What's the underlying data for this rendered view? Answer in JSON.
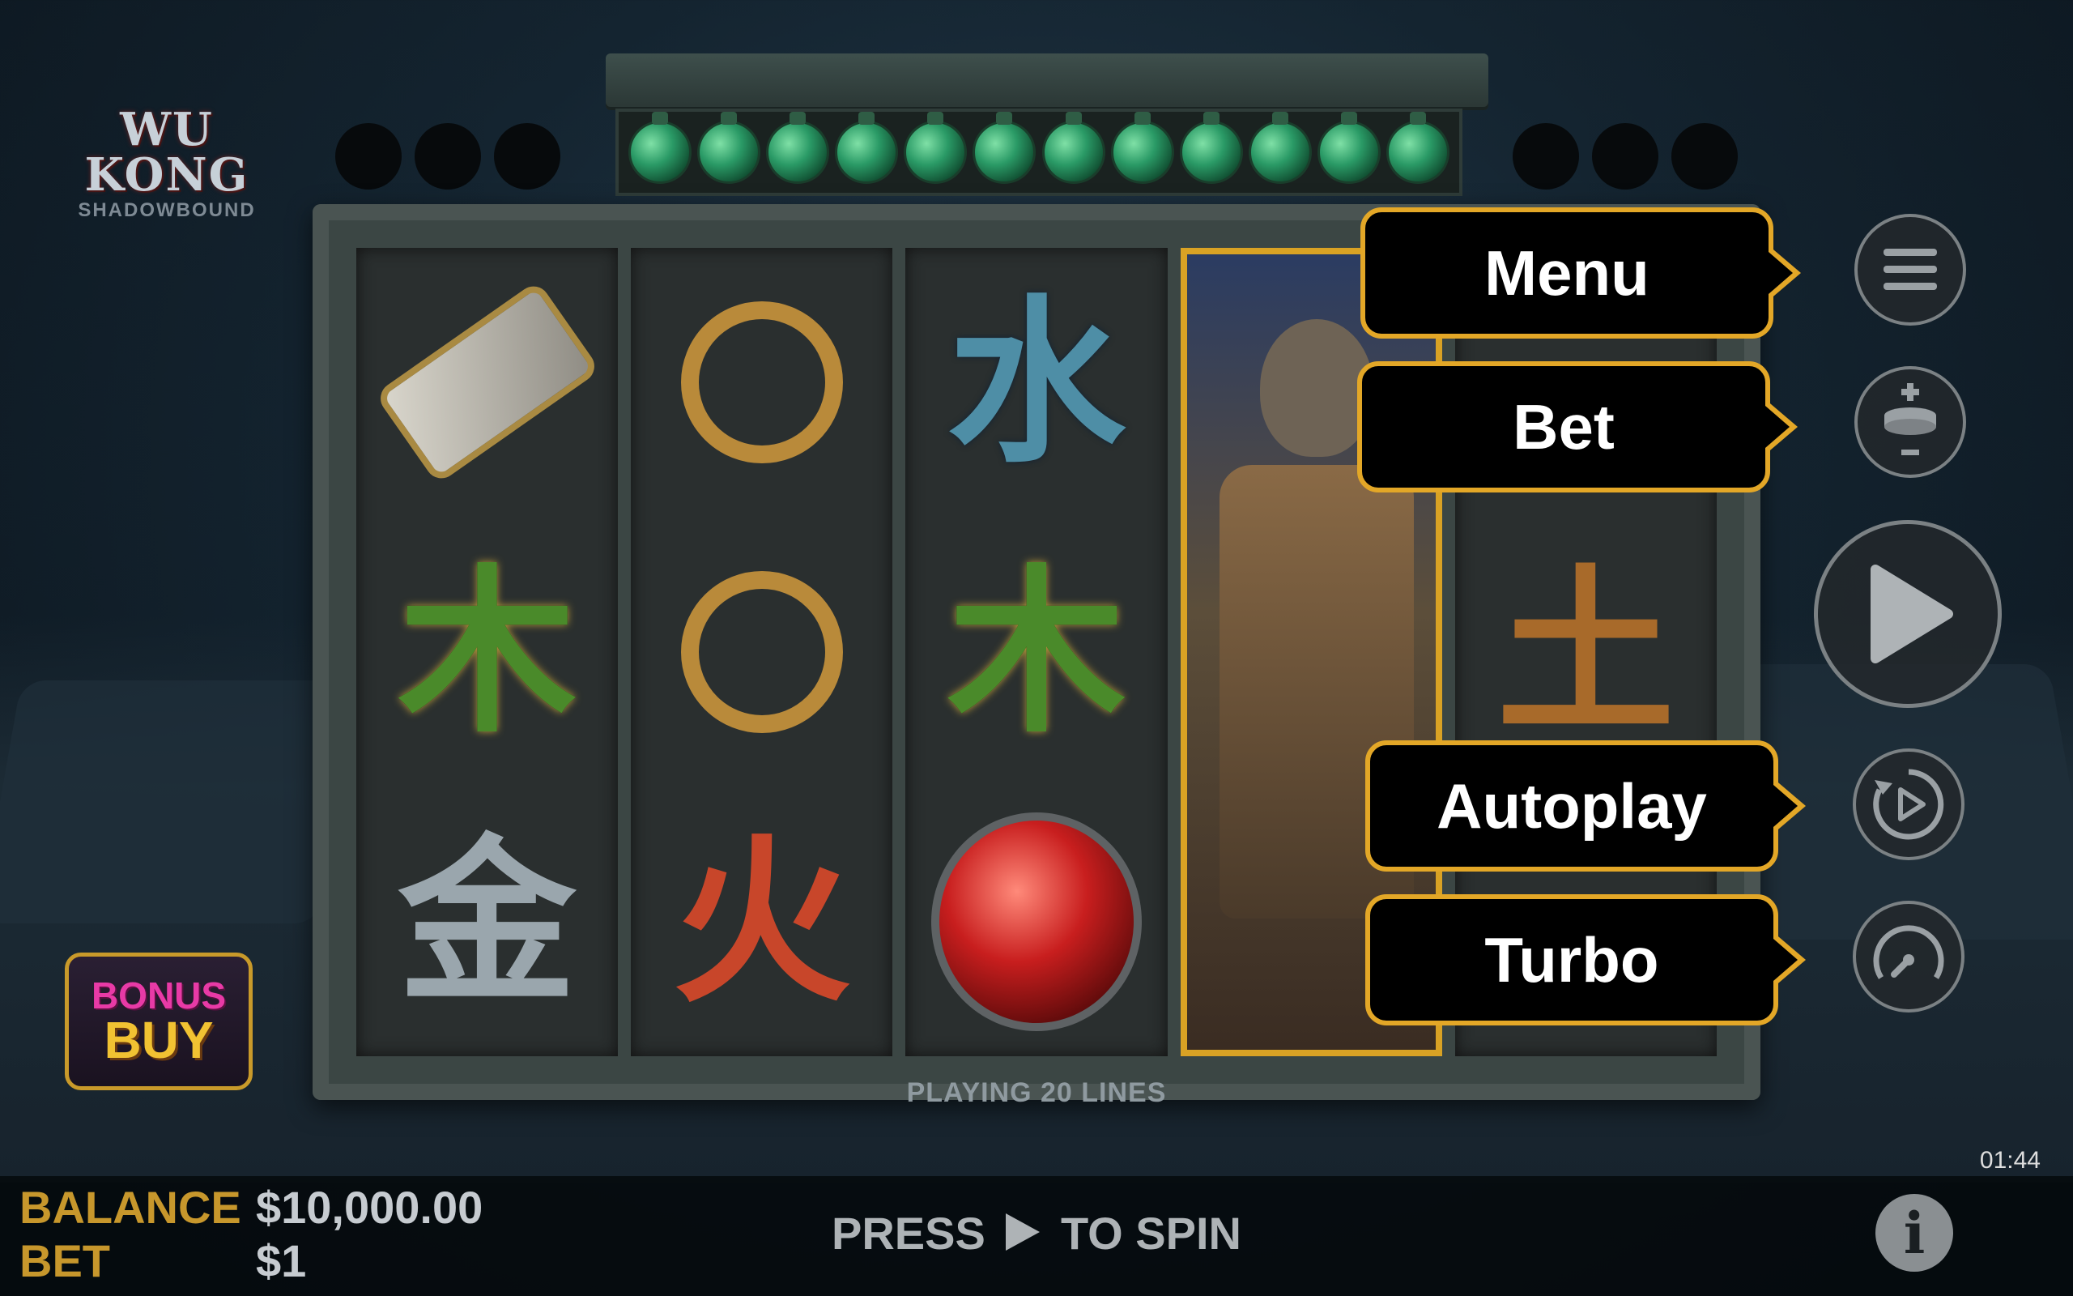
{
  "game": {
    "logo_line1": "WU KONG",
    "logo_line2": "SHADOWBOUND"
  },
  "reels": {
    "symbols": [
      [
        "scroll",
        "wood-kanji",
        "metal-kanji"
      ],
      [
        "golden-ring",
        "golden-ring",
        "fire-kanji"
      ],
      [
        "water-kanji",
        "wood-kanji",
        "red-orb"
      ],
      [
        "wukong-wild-expanded"
      ],
      [
        "hidden",
        "earth-kanji",
        "hidden"
      ]
    ],
    "kanji": {
      "water": "水",
      "wood": "木",
      "metal": "金",
      "fire": "火",
      "earth": "土"
    },
    "lines_label": "PLAYING 20 LINES"
  },
  "bonus_buy": {
    "line1": "BONUS",
    "line2": "BUY"
  },
  "tooltips": {
    "menu": "Menu",
    "bet": "Bet",
    "autoplay": "Autoplay",
    "turbo": "Turbo"
  },
  "buttons": {
    "menu_icon": "hamburger-icon",
    "bet_icon": "coin-stack-icon",
    "spin_icon": "play-icon",
    "autoplay_icon": "autoplay-icon",
    "turbo_icon": "speedometer-icon"
  },
  "footer": {
    "balance_label": "BALANCE",
    "balance_value": "$10,000.00",
    "bet_label": "BET",
    "bet_value": "$1",
    "press_prefix": "PRESS",
    "press_suffix": "TO SPIN",
    "clock": "01:44",
    "info_icon": "info-icon"
  },
  "colors": {
    "accent_gold": "#e3a727",
    "label_gold": "#c7972c",
    "tooltip_bg": "#000000"
  }
}
